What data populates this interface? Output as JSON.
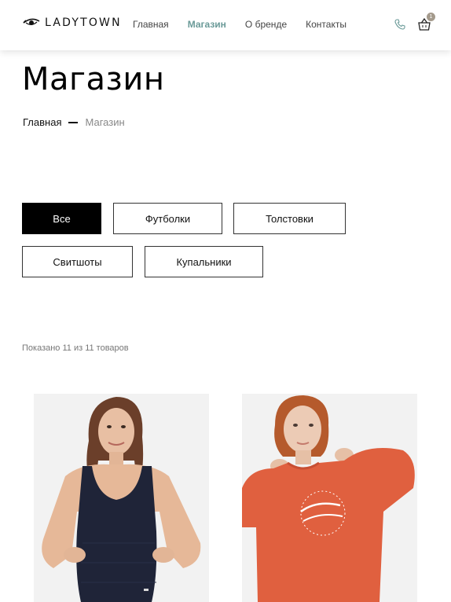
{
  "header": {
    "logo_text": "LADYTOWN",
    "nav": [
      {
        "label": "Главная",
        "active": false
      },
      {
        "label": "Магазин",
        "active": true
      },
      {
        "label": "О бренде",
        "active": false
      },
      {
        "label": "Контакты",
        "active": false
      }
    ],
    "cart_count": "1",
    "accent_color": "#6a9a98"
  },
  "page": {
    "title": "Магазин",
    "breadcrumb": {
      "home": "Главная",
      "current": "Магазин"
    }
  },
  "filters": [
    {
      "label": "Все",
      "active": true
    },
    {
      "label": "Футболки",
      "active": false
    },
    {
      "label": "Толстовки",
      "active": false
    },
    {
      "label": "Свитшоты",
      "active": false
    },
    {
      "label": "Купальники",
      "active": false
    }
  ],
  "results_text": "Показано 11 из 11 товаров",
  "products": [
    {
      "image": "swimsuit-photo",
      "garment_color": "#1f2438"
    },
    {
      "image": "sweatshirt-photo",
      "garment_color": "#e0603f"
    }
  ]
}
